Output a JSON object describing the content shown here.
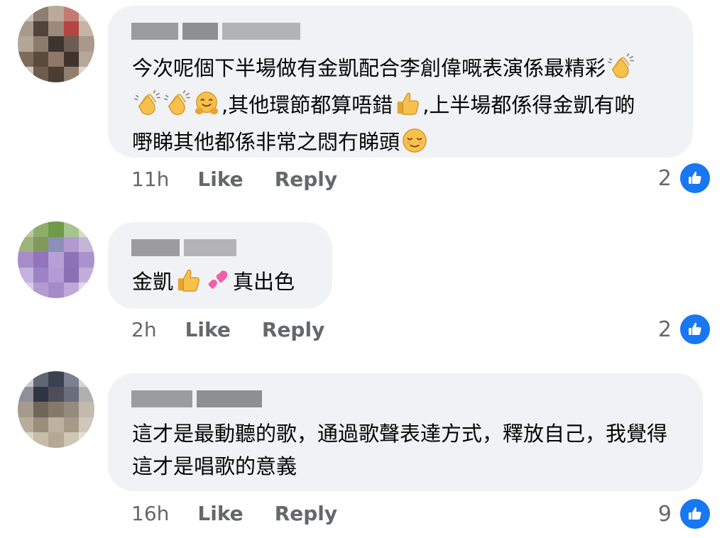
{
  "comments": [
    {
      "text_1": "今次呢個下半場做有金凱配合李創偉嘅表演係最精彩",
      "text_2": ",其他環節都算唔錯",
      "text_3": ",上半場都係得金凱有啲",
      "text_4": "嘢睇其他都係非常之悶冇睇頭",
      "time": "11h",
      "like_label": "Like",
      "reply_label": "Reply",
      "reaction_count": "2"
    },
    {
      "text_1": "金凱",
      "text_2": "真出色",
      "time": "2h",
      "like_label": "Like",
      "reply_label": "Reply",
      "reaction_count": "2"
    },
    {
      "text_1": "這才是最動聽的歌，通過歌聲表達方式，釋放自己，我覺得",
      "text_2": "這才是唱歌的意義",
      "time": "16h",
      "like_label": "Like",
      "reply_label": "Reply",
      "reaction_count": "9"
    }
  ],
  "icons": {
    "reaction": "thumbs-up-icon",
    "emoji_clap": "clapping-hands-icon",
    "emoji_hug": "hugging-face-icon",
    "emoji_thumb": "thumbs-up-emoji-icon",
    "emoji_relieved": "relieved-face-icon",
    "emoji_hearts": "two-hearts-icon"
  },
  "colors": {
    "bubble": "#f0f2f5",
    "meta_text": "#65676b",
    "like_blue": "#1877f2"
  }
}
